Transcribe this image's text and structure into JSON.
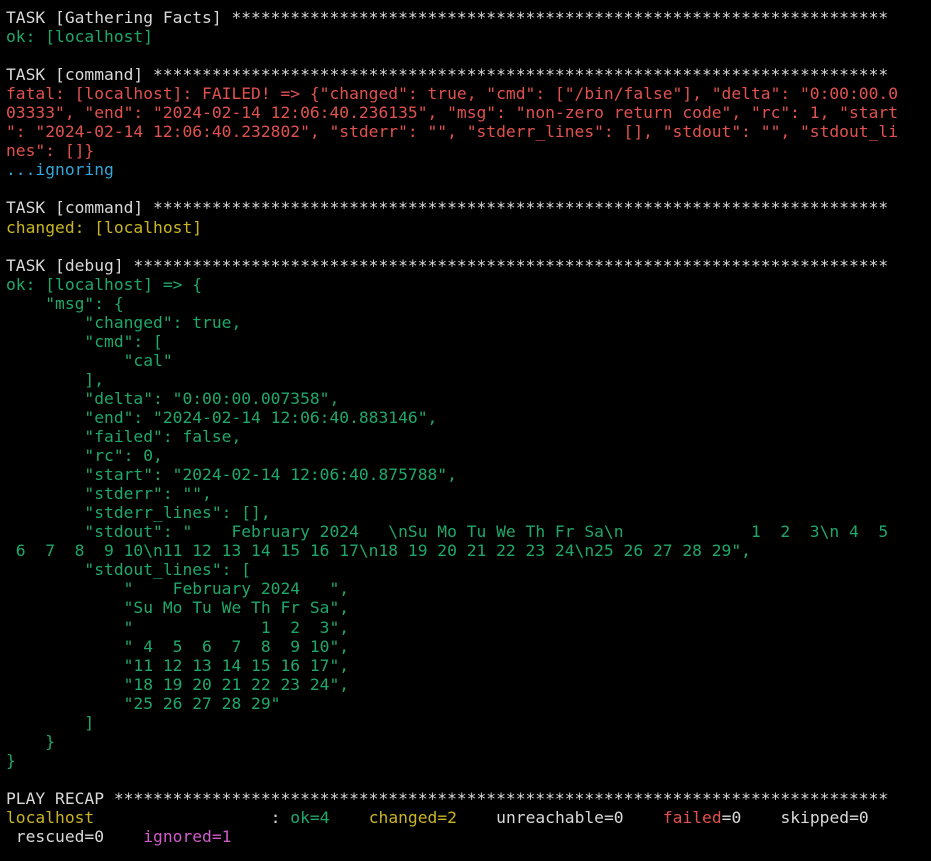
{
  "colors": {
    "background": "#000000",
    "default_text": "#d9d9d9",
    "ok": "#1fa86a",
    "fatal": "#e0524f",
    "changed": "#c9b522",
    "ignoring": "#34a7d8",
    "ignored": "#d05cc8"
  },
  "lines": [
    {
      "segments": [
        {
          "color": "white",
          "text": "TASK [Gathering Facts] *******************************************************************"
        }
      ]
    },
    {
      "segments": [
        {
          "color": "green",
          "text": "ok: [localhost]"
        }
      ]
    },
    {
      "segments": [
        {
          "color": "white",
          "text": ""
        }
      ]
    },
    {
      "segments": [
        {
          "color": "white",
          "text": "TASK [command] ***************************************************************************"
        }
      ]
    },
    {
      "segments": [
        {
          "color": "red",
          "text": "fatal: [localhost]: FAILED! => {\"changed\": true, \"cmd\": [\"/bin/false\"], \"delta\": \"0:00:00.0"
        }
      ]
    },
    {
      "segments": [
        {
          "color": "red",
          "text": "03333\", \"end\": \"2024-02-14 12:06:40.236135\", \"msg\": \"non-zero return code\", \"rc\": 1, \"start"
        }
      ]
    },
    {
      "segments": [
        {
          "color": "red",
          "text": "\": \"2024-02-14 12:06:40.232802\", \"stderr\": \"\", \"stderr_lines\": [], \"stdout\": \"\", \"stdout_li"
        }
      ]
    },
    {
      "segments": [
        {
          "color": "red",
          "text": "nes\": []}"
        }
      ]
    },
    {
      "segments": [
        {
          "color": "cyan",
          "text": "...ignoring"
        }
      ]
    },
    {
      "segments": [
        {
          "color": "white",
          "text": ""
        }
      ]
    },
    {
      "segments": [
        {
          "color": "white",
          "text": "TASK [command] ***************************************************************************"
        }
      ]
    },
    {
      "segments": [
        {
          "color": "yellow",
          "text": "changed: [localhost]"
        }
      ]
    },
    {
      "segments": [
        {
          "color": "white",
          "text": ""
        }
      ]
    },
    {
      "segments": [
        {
          "color": "white",
          "text": "TASK [debug] *****************************************************************************"
        }
      ]
    },
    {
      "segments": [
        {
          "color": "green",
          "text": "ok: [localhost] => {"
        }
      ]
    },
    {
      "segments": [
        {
          "color": "green",
          "text": "    \"msg\": {"
        }
      ]
    },
    {
      "segments": [
        {
          "color": "green",
          "text": "        \"changed\": true,"
        }
      ]
    },
    {
      "segments": [
        {
          "color": "green",
          "text": "        \"cmd\": ["
        }
      ]
    },
    {
      "segments": [
        {
          "color": "green",
          "text": "            \"cal\""
        }
      ]
    },
    {
      "segments": [
        {
          "color": "green",
          "text": "        ],"
        }
      ]
    },
    {
      "segments": [
        {
          "color": "green",
          "text": "        \"delta\": \"0:00:00.007358\","
        }
      ]
    },
    {
      "segments": [
        {
          "color": "green",
          "text": "        \"end\": \"2024-02-14 12:06:40.883146\","
        }
      ]
    },
    {
      "segments": [
        {
          "color": "green",
          "text": "        \"failed\": false,"
        }
      ]
    },
    {
      "segments": [
        {
          "color": "green",
          "text": "        \"rc\": 0,"
        }
      ]
    },
    {
      "segments": [
        {
          "color": "green",
          "text": "        \"start\": \"2024-02-14 12:06:40.875788\","
        }
      ]
    },
    {
      "segments": [
        {
          "color": "green",
          "text": "        \"stderr\": \"\","
        }
      ]
    },
    {
      "segments": [
        {
          "color": "green",
          "text": "        \"stderr_lines\": [],"
        }
      ]
    },
    {
      "segments": [
        {
          "color": "green",
          "text": "        \"stdout\": \"    February 2024   \\nSu Mo Tu We Th Fr Sa\\n             1  2  3\\n 4  5"
        }
      ]
    },
    {
      "segments": [
        {
          "color": "green",
          "text": " 6  7  8  9 10\\n11 12 13 14 15 16 17\\n18 19 20 21 22 23 24\\n25 26 27 28 29\","
        }
      ]
    },
    {
      "segments": [
        {
          "color": "green",
          "text": "        \"stdout_lines\": ["
        }
      ]
    },
    {
      "segments": [
        {
          "color": "green",
          "text": "            \"    February 2024   \","
        }
      ]
    },
    {
      "segments": [
        {
          "color": "green",
          "text": "            \"Su Mo Tu We Th Fr Sa\","
        }
      ]
    },
    {
      "segments": [
        {
          "color": "green",
          "text": "            \"             1  2  3\","
        }
      ]
    },
    {
      "segments": [
        {
          "color": "green",
          "text": "            \" 4  5  6  7  8  9 10\","
        }
      ]
    },
    {
      "segments": [
        {
          "color": "green",
          "text": "            \"11 12 13 14 15 16 17\","
        }
      ]
    },
    {
      "segments": [
        {
          "color": "green",
          "text": "            \"18 19 20 21 22 23 24\","
        }
      ]
    },
    {
      "segments": [
        {
          "color": "green",
          "text": "            \"25 26 27 28 29\""
        }
      ]
    },
    {
      "segments": [
        {
          "color": "green",
          "text": "        ]"
        }
      ]
    },
    {
      "segments": [
        {
          "color": "green",
          "text": "    }"
        }
      ]
    },
    {
      "segments": [
        {
          "color": "green",
          "text": "}"
        }
      ]
    },
    {
      "segments": [
        {
          "color": "white",
          "text": ""
        }
      ]
    },
    {
      "segments": [
        {
          "color": "white",
          "text": "PLAY RECAP *******************************************************************************"
        }
      ]
    },
    {
      "segments": [
        {
          "color": "yellow",
          "text": "localhost"
        },
        {
          "color": "white",
          "text": "                  : "
        },
        {
          "color": "green",
          "text": "ok=4"
        },
        {
          "color": "white",
          "text": "    "
        },
        {
          "color": "yellow",
          "text": "changed=2"
        },
        {
          "color": "white",
          "text": "    unreachable=0    "
        },
        {
          "color": "red",
          "text": "failed"
        },
        {
          "color": "white",
          "text": "=0    skipped=0"
        }
      ]
    },
    {
      "segments": [
        {
          "color": "white",
          "text": " rescued=0    "
        },
        {
          "color": "magenta",
          "text": "ignored=1"
        }
      ]
    }
  ]
}
